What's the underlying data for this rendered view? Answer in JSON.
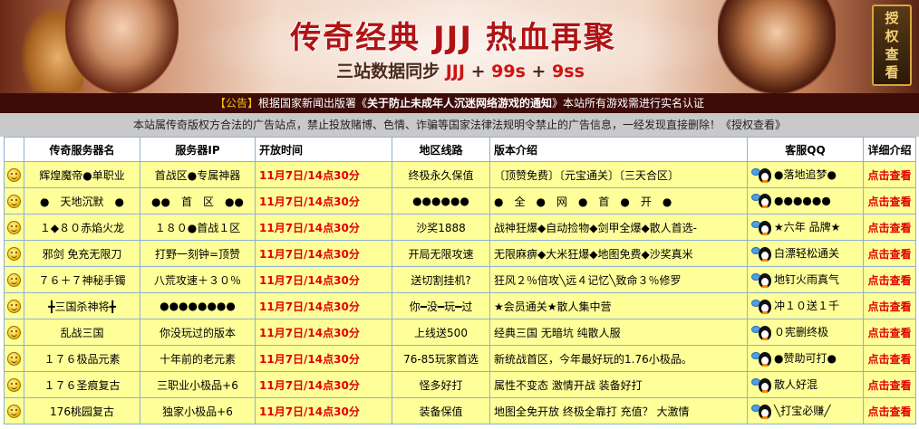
{
  "banner": {
    "title": "传奇经典 JJJ 热血再聚",
    "subtitle_prefix": "三站数据同步",
    "subtitle_a": "JJJ",
    "subtitle_sep1": "+",
    "subtitle_b": "99s",
    "subtitle_sep2": "+",
    "subtitle_c": "9ss",
    "auth_button": [
      "授",
      "权",
      "查",
      "看"
    ]
  },
  "notice": {
    "tag": "【公告】",
    "text_before": "根据国家新闻出版署《",
    "doc_title": "关于防止未成年人沉迷网络游戏的通知",
    "text_after": "》本站所有游戏需进行实名认证"
  },
  "disclaimer": "本站属传奇版权方合法的广告站点，禁止投放赌博、色情、诈骗等国家法律法规明令禁止的广告信息，一经发现直接删除！《授权查看》",
  "table": {
    "headers": [
      "传奇服务器名",
      "服务器IP",
      "开放时间",
      "地区线路",
      "版本介绍",
      "客服QQ",
      "详细介绍"
    ],
    "rows": [
      {
        "name": "辉煌魔帝●单职业",
        "ip": "首战区●专属神器",
        "time": "11月7日/14点30分",
        "route": "终极永久保值",
        "intro": "〔顶赞免费〕〔元宝通关〕〔三天合区〕",
        "qq": "●落地追梦●",
        "link": "点击查看"
      },
      {
        "name": "●　天地沉默　●",
        "ip": "●●　首　区　●●",
        "time": "11月7日/14点30分",
        "route": "●●●●●●",
        "intro": "●　全　●　网　●　首　●　开　●",
        "qq": "●●●●●●",
        "link": "点击查看"
      },
      {
        "name": "１◆８０赤焰火龙",
        "ip": "１８０●首战１区",
        "time": "11月7日/14点30分",
        "route": "沙奖1888",
        "intro": "战神狂爆◆自动捡物◆剑甲全爆◆散人首选-",
        "qq": "★六年 品牌★",
        "link": "点击查看"
      },
      {
        "name": "邪剑 免充无限刀",
        "ip": "打野一刻钟=顶赞",
        "time": "11月7日/14点30分",
        "route": "开局无限攻速",
        "intro": "无限麻痹◆大米狂爆◆地图免费◆沙奖真米",
        "qq": "白漂轻松通关",
        "link": "点击查看"
      },
      {
        "name": "７６＋７神秘手镯",
        "ip": "八荒攻速＋３０％",
        "time": "11月7日/14点30分",
        "route": "送切割挂机?",
        "intro": "狂风２％倍攻╲远４记忆╲致命３％修罗",
        "qq": "地钉火雨真气",
        "link": "点击查看"
      },
      {
        "name": "╋三国杀神将╋",
        "ip": "●●●●●●●●",
        "time": "11月7日/14点30分",
        "route": "你━没━玩━过",
        "intro": "★会员通关★散人集中营",
        "qq": "冲１０送１千",
        "link": "点击查看"
      },
      {
        "name": "乱战三国",
        "ip": "你没玩过的版本",
        "time": "11月7日/14点30分",
        "route": "上线送500",
        "intro": "经典三国 无暗坑 纯散人服",
        "qq": "０宪删终极",
        "link": "点击查看"
      },
      {
        "name": "１７６极品元素",
        "ip": "十年前的老元素",
        "time": "11月7日/14点30分",
        "route": "76-85玩家首选",
        "intro": "新统战首区，今年最好玩的1.76小极品。",
        "qq": "●赞助可打●",
        "link": "点击查看"
      },
      {
        "name": "１７６圣痕复古",
        "ip": "三职业小极品+6",
        "time": "11月7日/14点30分",
        "route": "怪多好打",
        "intro": "属性不变态 激情开战 装备好打",
        "qq": "散人好混",
        "link": "点击查看"
      },
      {
        "name": "176桃园复古",
        "ip": "独家小极品+6",
        "time": "11月7日/14点30分",
        "route": "装备保值",
        "intro": "地图全免开放 终极全靠打 充值？ 大激情",
        "qq": "╲打宝必赚╱",
        "link": "点击查看"
      }
    ]
  },
  "icons": {
    "row_marker": "smiley-icon",
    "qq": "qq-penguin-icon"
  },
  "colors": {
    "accent_red": "#e00000",
    "row_bg": "#ffff99",
    "notice_bg": "#3d0c08",
    "border": "#8fb1d2"
  }
}
